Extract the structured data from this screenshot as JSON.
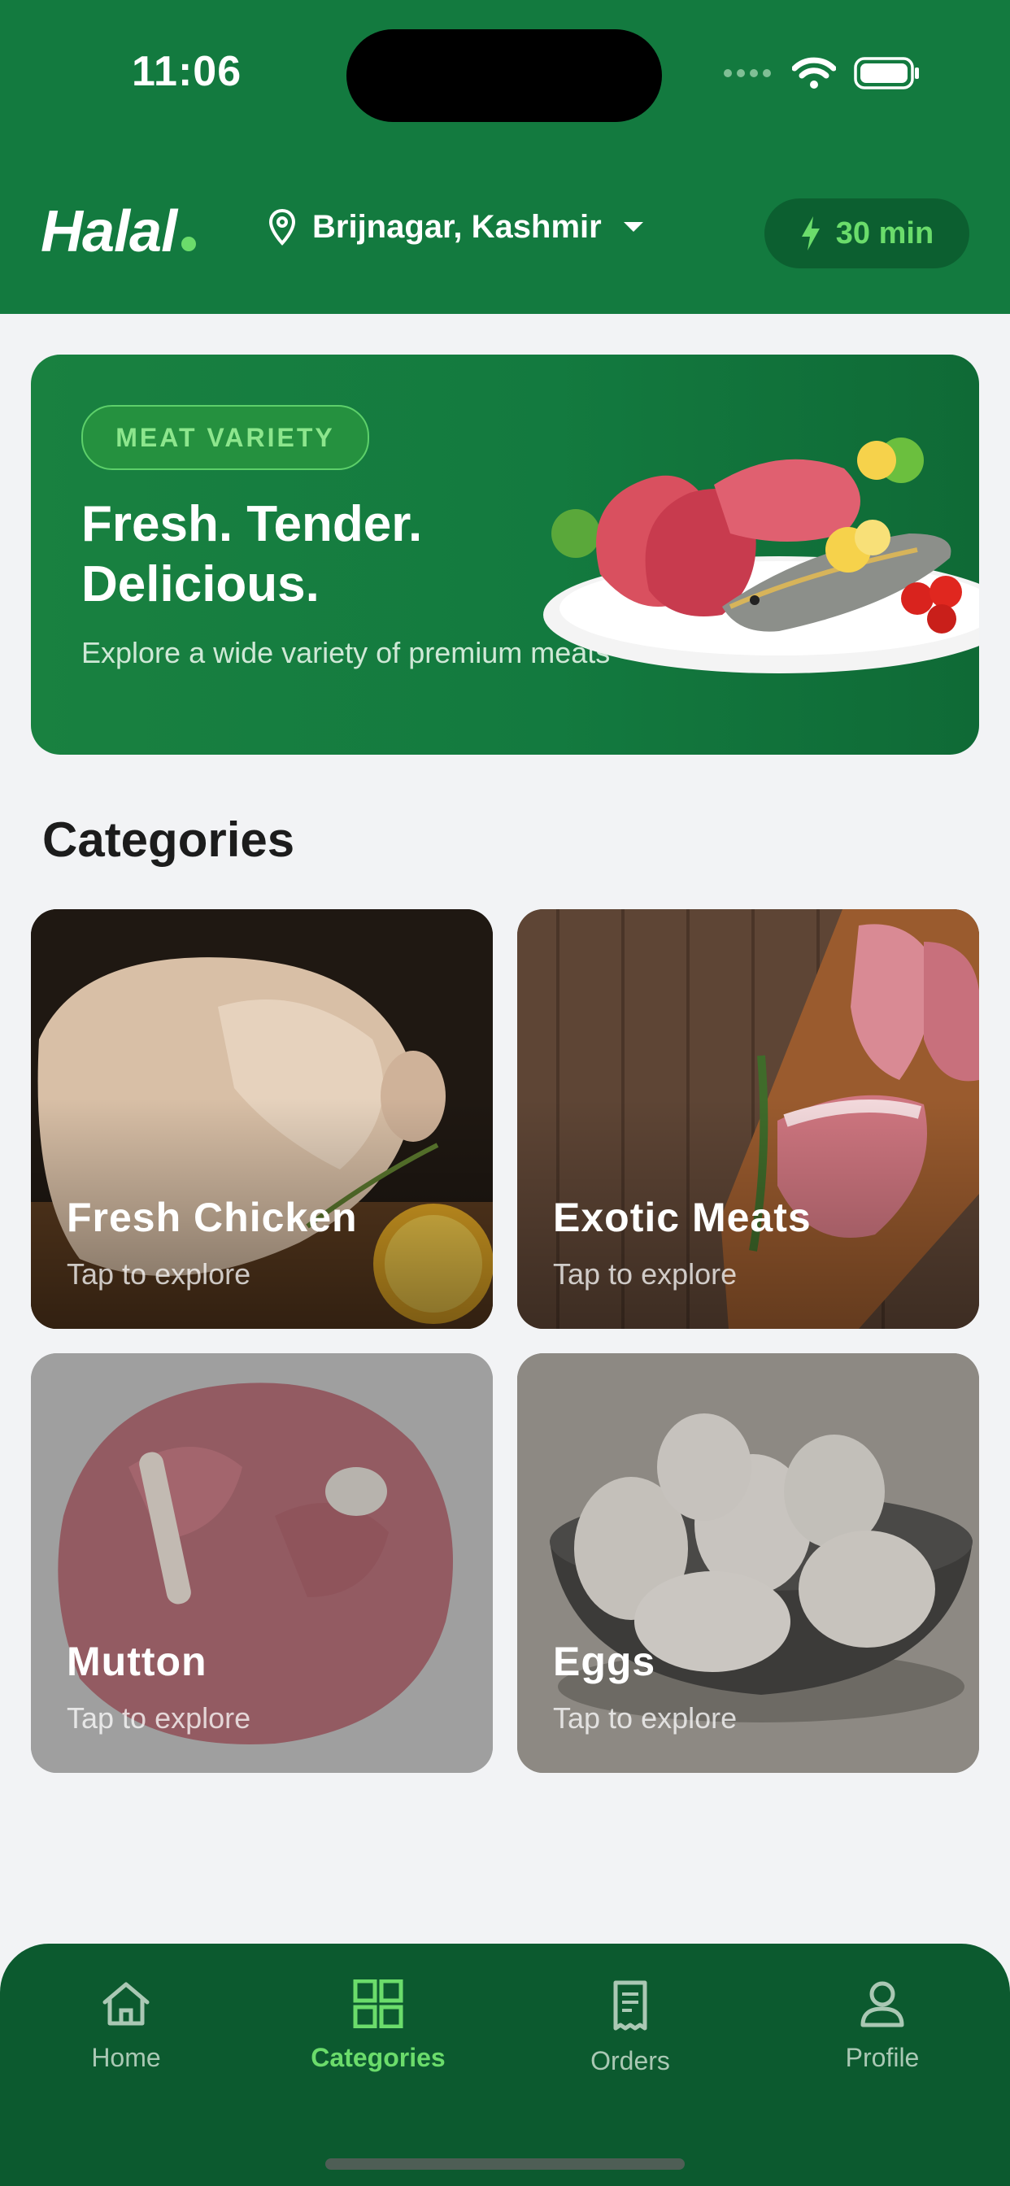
{
  "status_bar": {
    "time": "11:06"
  },
  "header": {
    "brand": "Halal",
    "location": "Brijnagar, Kashmir",
    "eta": "30 min"
  },
  "banner": {
    "tag": "MEAT VARIETY",
    "headline_1": "Fresh. Tender.",
    "headline_2": "Delicious.",
    "subtitle": "Explore a wide variety of premium meats"
  },
  "categories": {
    "title": "Categories",
    "items": [
      {
        "name": "Fresh Chicken",
        "sub": "Tap to explore"
      },
      {
        "name": "Exotic Meats",
        "sub": "Tap to explore"
      },
      {
        "name": "Mutton",
        "sub": "Tap to explore"
      },
      {
        "name": "Eggs",
        "sub": "Tap to explore"
      }
    ]
  },
  "nav": {
    "items": [
      {
        "label": "Home",
        "icon": "home-icon"
      },
      {
        "label": "Categories",
        "icon": "grid-icon",
        "active": true
      },
      {
        "label": "Orders",
        "icon": "receipt-icon"
      },
      {
        "label": "Profile",
        "icon": "user-icon"
      }
    ]
  },
  "colors": {
    "primary": "#137a3f",
    "accent": "#6bdc6b",
    "nav_bg": "#0c5a2f",
    "background": "#f2f3f5"
  }
}
